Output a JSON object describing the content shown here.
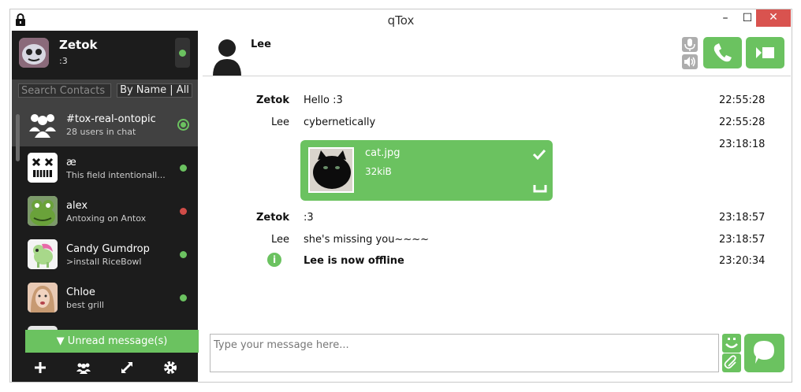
{
  "window": {
    "title": "qTox",
    "minimize": "–",
    "maximize": "☐",
    "close": "✕"
  },
  "profile": {
    "name": "Zetok",
    "status_message": ":3",
    "status": "online"
  },
  "contacts_filter": {
    "search_placeholder": "Search Contacts",
    "filter_label": "By Name | All"
  },
  "contacts": [
    {
      "name": "#tox-real-ontopic",
      "status_message": "28 users in chat",
      "status": "group",
      "active": true
    },
    {
      "name": "æ",
      "status_message": "This field intentionall...",
      "status": "online"
    },
    {
      "name": "alex",
      "status_message": "Antoxing on Antox",
      "status": "busy"
    },
    {
      "name": "Candy Gumdrop",
      "status_message": ">install RiceBowl",
      "status": "online"
    },
    {
      "name": "Chloe",
      "status_message": "best grill",
      "status": "online"
    }
  ],
  "unread_label": "▼ Unread message(s)",
  "bottom_bar": [
    "add-icon",
    "group-icon",
    "transfer-icon",
    "settings-icon"
  ],
  "chat": {
    "contact_name": "Lee",
    "messages": [
      {
        "author": "Zetok",
        "author_bold": true,
        "text": "Hello :3",
        "time": "22:55:28"
      },
      {
        "author": "Lee",
        "author_bold": false,
        "text": "cybernetically",
        "time": "22:55:28"
      },
      {
        "author": "",
        "author_bold": false,
        "text": "",
        "time": "23:18:18"
      },
      {
        "author": "Zetok",
        "author_bold": true,
        "text": ":3",
        "time": "23:18:57"
      },
      {
        "author": "Lee",
        "author_bold": false,
        "text": "she's missing you~~~~",
        "time": "23:18:57"
      },
      {
        "author": "",
        "author_bold": false,
        "text": "Lee is now offline",
        "time": "23:20:34"
      }
    ],
    "file_transfer": {
      "file_name": "cat.jpg",
      "file_size": "32kiB"
    },
    "info_glyph": "i"
  },
  "composer": {
    "placeholder": "Type your message here..."
  },
  "colors": {
    "accent": "#6bc260",
    "busy": "#d04c48",
    "sidebar": "#1c1c1c",
    "sidebar_active": "#414141",
    "close_button": "#d9534f"
  }
}
